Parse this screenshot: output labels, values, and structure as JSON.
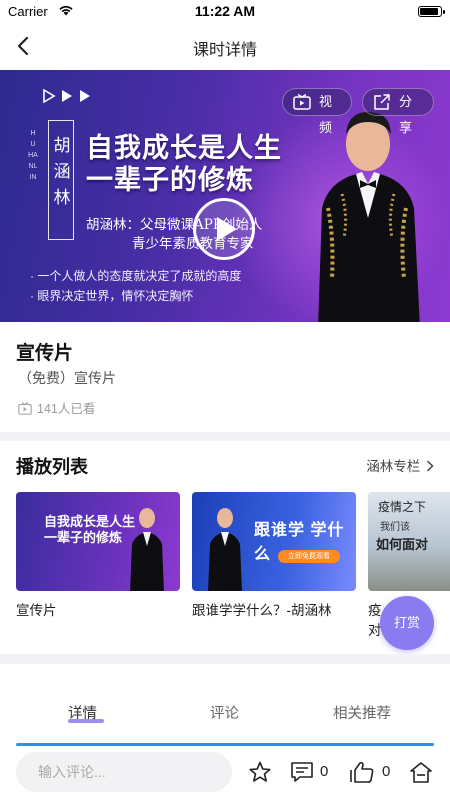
{
  "status_bar": {
    "carrier": "Carrier",
    "time": "11:22 AM"
  },
  "nav": {
    "title": "课时详情"
  },
  "hero": {
    "vertical_name": "胡涵林",
    "vertical_name_en": "HUHANLIN",
    "headline_line1": "自我成长是人生",
    "headline_line2": "一辈子的修炼",
    "subtitle_line1": "胡涵林：父母微课APP创始人",
    "subtitle_line2": "青少年素质教育专家",
    "bullet1": "· 一个人做人的态度就决定了成就的高度",
    "bullet2": "· 眼界决定世界，情怀决定胸怀",
    "video_chip": "视频",
    "share_chip": "分享"
  },
  "lesson": {
    "title": "宣传片",
    "subtitle": "（免费）宣传片",
    "views": "141人已看"
  },
  "playlist": {
    "title": "播放列表",
    "more": "涵林专栏",
    "items": [
      {
        "caption": "宣传片",
        "thumb_text": "自我成长是人生\n一辈子的修炼"
      },
      {
        "caption": "跟谁学学什么？-胡涵林",
        "thumb_text": "跟谁学 学什么",
        "thumb_button": "立即免费观看"
      },
      {
        "caption": "疫",
        "caption2": "对",
        "thumb_text": "疫情之下",
        "thumb_text2": "我们该",
        "thumb_text3": "如何面对"
      }
    ]
  },
  "reward_button": "打赏",
  "tabs": [
    {
      "label": "详情",
      "active": true
    },
    {
      "label": "评论",
      "active": false
    },
    {
      "label": "相关推荐",
      "active": false
    }
  ],
  "bottom_bar": {
    "comment_placeholder": "输入评论...",
    "comment_count": "0",
    "like_count": "0"
  },
  "colors": {
    "accent_purple": "#8b7bf0",
    "tab_line_blue": "#2f8fe0",
    "hero_gradient_start": "#2d2a8f",
    "hero_gradient_end": "#8d3ad0"
  },
  "icons": [
    "back-arrow-icon",
    "wifi-icon",
    "battery-icon",
    "video-icon",
    "share-icon",
    "play-icon",
    "tv-icon",
    "chevron-right-icon",
    "star-icon",
    "comment-icon",
    "like-icon",
    "home-icon"
  ]
}
